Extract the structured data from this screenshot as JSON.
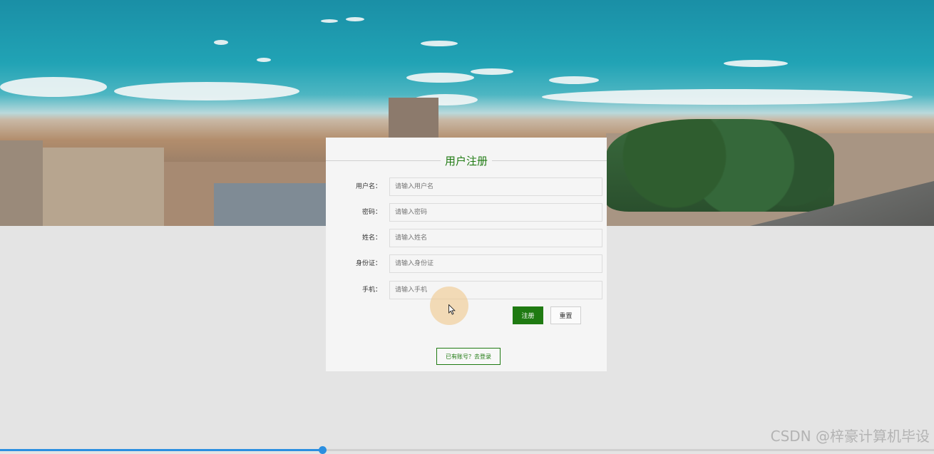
{
  "form": {
    "title": "用户注册",
    "fields": [
      {
        "label": "用户名：",
        "placeholder": "请输入用户名"
      },
      {
        "label": "密码：",
        "placeholder": "请输入密码"
      },
      {
        "label": "姓名：",
        "placeholder": "请输入姓名"
      },
      {
        "label": "身份证：",
        "placeholder": "请输入身份证"
      },
      {
        "label": "手机：",
        "placeholder": "请输入手机"
      }
    ],
    "submit_label": "注册",
    "reset_label": "重置",
    "login_link": "已有账号？去登录"
  },
  "watermark": "CSDN @梓豪计算机毕设",
  "video_progress": 0.345,
  "colors": {
    "accent": "#1f7a12",
    "page_bg": "#e4e4e4",
    "card_bg": "#f5f5f5"
  }
}
